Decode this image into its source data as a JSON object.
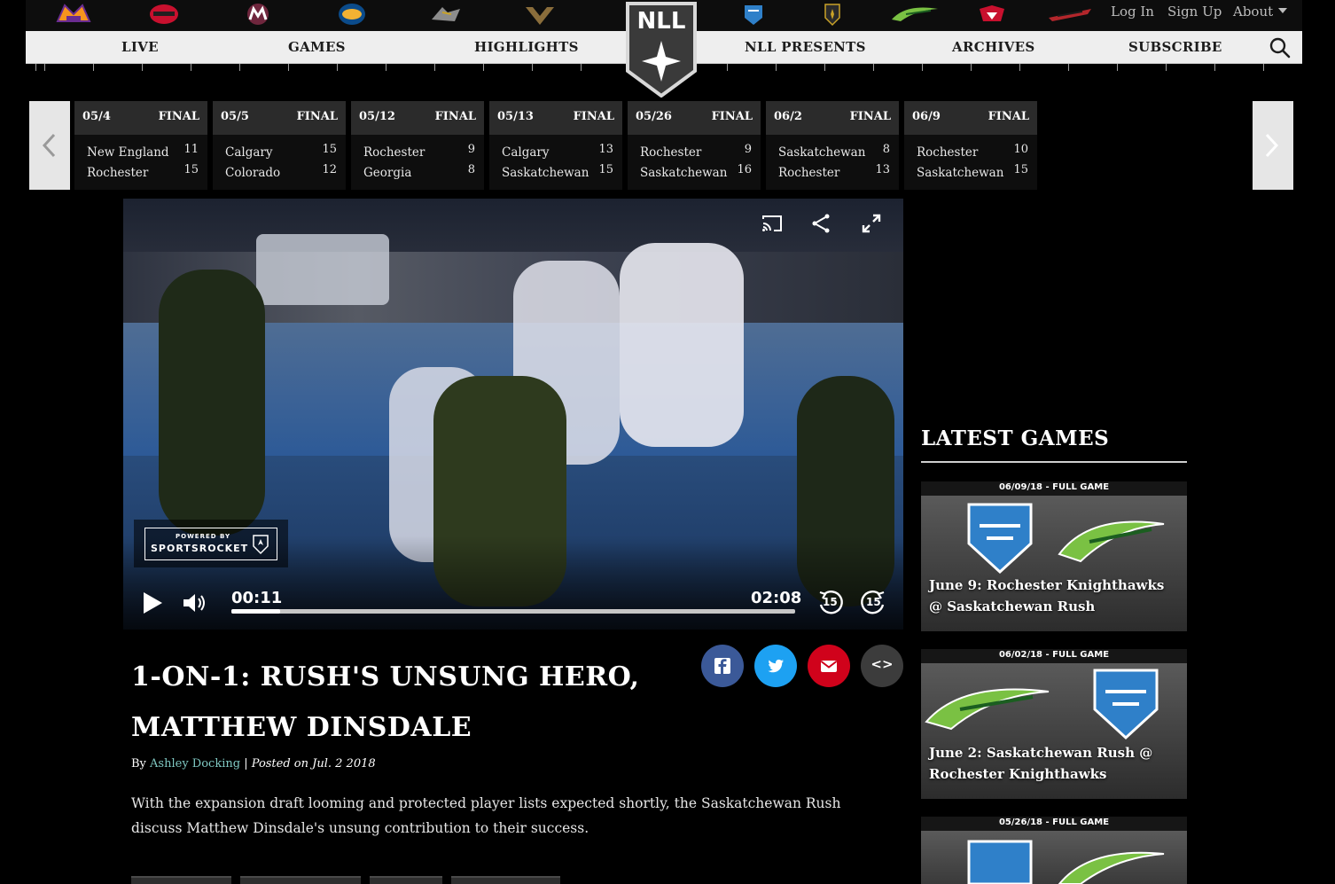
{
  "topbar": {
    "teams": [
      "bandits-logo",
      "roughnecks-logo",
      "mammoth-logo",
      "swarm-logo",
      "black-wolves-logo",
      "thunderbirds-logo",
      "knighthawks-logo",
      "nll-badge-logo",
      "rush-logo",
      "rock-logo",
      "stealth-logo"
    ],
    "login": "Log In",
    "signup": "Sign Up",
    "about": "About"
  },
  "nav": {
    "live": "LIVE",
    "games": "GAMES",
    "highlights": "HIGHLIGHTS",
    "nll_presents": "NLL PRESENTS",
    "archives": "ARCHIVES",
    "subscribe": "SUBSCRIBE",
    "logo_text": "NLL"
  },
  "scores": [
    {
      "date": "05/4",
      "status": "FINAL",
      "team1": "New England",
      "score1": "11",
      "team2": "Rochester",
      "score2": "15"
    },
    {
      "date": "05/5",
      "status": "FINAL",
      "team1": "Calgary",
      "score1": "15",
      "team2": "Colorado",
      "score2": "12"
    },
    {
      "date": "05/12",
      "status": "FINAL",
      "team1": "Rochester",
      "score1": "9",
      "team2": "Georgia",
      "score2": "8"
    },
    {
      "date": "05/13",
      "status": "FINAL",
      "team1": "Calgary",
      "score1": "13",
      "team2": "Saskatchewan",
      "score2": "15"
    },
    {
      "date": "05/26",
      "status": "FINAL",
      "team1": "Rochester",
      "score1": "9",
      "team2": "Saskatchewan",
      "score2": "16"
    },
    {
      "date": "06/2",
      "status": "FINAL",
      "team1": "Saskatchewan",
      "score1": "8",
      "team2": "Rochester",
      "score2": "13"
    },
    {
      "date": "06/9",
      "status": "FINAL",
      "team1": "Rochester",
      "score1": "10",
      "team2": "Saskatchewan",
      "score2": "15"
    }
  ],
  "video": {
    "current_time": "00:11",
    "duration": "02:08",
    "progress_fraction": 0.086,
    "skip_back": "15",
    "skip_forward": "15",
    "powered_by": "POWERED BY",
    "brand": "SPORTSROCKET"
  },
  "article": {
    "title": "1-ON-1: RUSH'S UNSUNG HERO, MATTHEW DINSDALE",
    "by": "By ",
    "author": "Ashley Docking",
    "separator": " | ",
    "posted": "Posted on Jul. 2 2018",
    "summary": "With the expansion draft looming and protected player lists expected shortly, the Saskatchewan Rush discuss Matthew Dinsdale's unsung contribution to their success.",
    "embed_label": "<>"
  },
  "sidebar": {
    "title": "LATEST GAMES",
    "games": [
      {
        "banner": "06/09/18 - FULL GAME",
        "caption": "June 9: Rochester Knighthawks @ Saskatchewan Rush"
      },
      {
        "banner": "06/02/18 - FULL GAME",
        "caption": "June 2: Saskatchewan Rush @ Rochester Knighthawks"
      },
      {
        "banner": "05/26/18 - FULL GAME",
        "caption": ""
      }
    ]
  },
  "colors": {
    "facebook": "#3b5998",
    "twitter": "#1da1f2",
    "email": "#d0021b",
    "embed": "#3c3c3c",
    "author_link": "#7fc8c2",
    "nav_bg": "#eeeeee"
  }
}
